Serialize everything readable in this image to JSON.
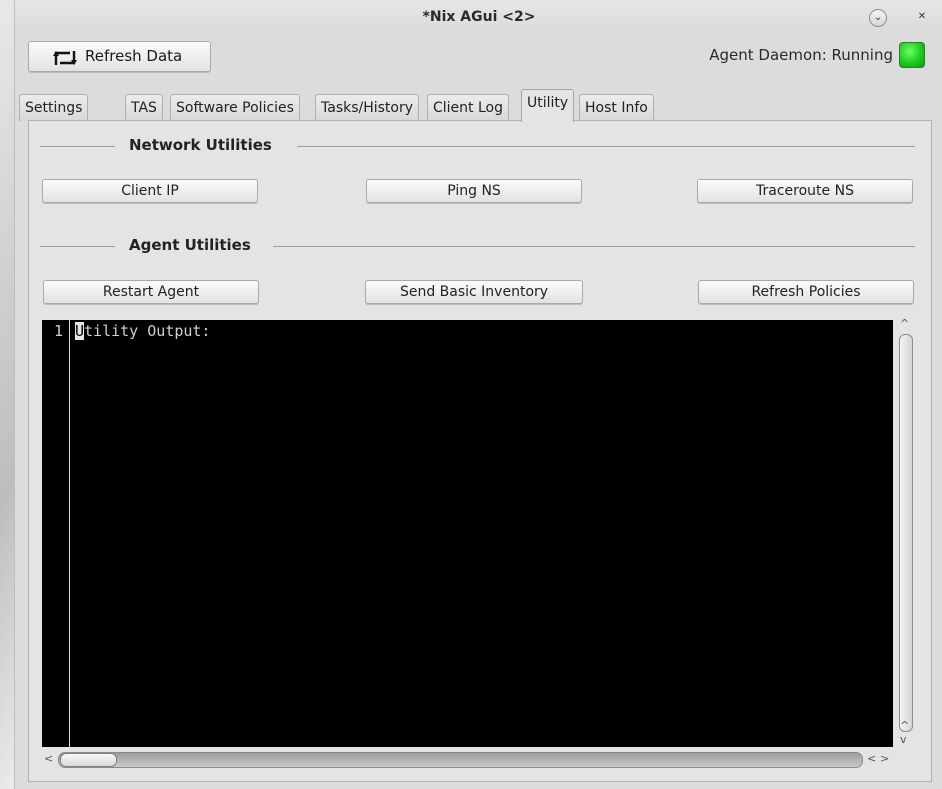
{
  "window": {
    "title": "*Nix AGui <2>",
    "minimize_glyph": "⌄",
    "close_glyph": "✕"
  },
  "toolbar": {
    "refresh_label": "Refresh Data",
    "refresh_icon": "refresh-arrows-icon",
    "daemon_status": "Agent Daemon: Running",
    "daemon_status_color": "#19c619"
  },
  "tabs": [
    {
      "label": "Settings",
      "active": false
    },
    {
      "label": "TAS",
      "active": false
    },
    {
      "label": "Software Policies",
      "active": false
    },
    {
      "label": "Tasks/History",
      "active": false
    },
    {
      "label": "Client Log",
      "active": false
    },
    {
      "label": "Utility",
      "active": true
    },
    {
      "label": "Host Info",
      "active": false
    }
  ],
  "network": {
    "title": "Network Utilities",
    "buttons": [
      "Client IP",
      "Ping NS",
      "Traceroute NS"
    ]
  },
  "agent": {
    "title": "Agent Utilities",
    "buttons": [
      "Restart Agent",
      "Send Basic Inventory",
      "Refresh Policies"
    ]
  },
  "output": {
    "line_number": "1",
    "first_char": "U",
    "rest_text": "tility Output:"
  },
  "scroll": {
    "up": "^",
    "down": "v",
    "left": "<",
    "right": ">"
  }
}
